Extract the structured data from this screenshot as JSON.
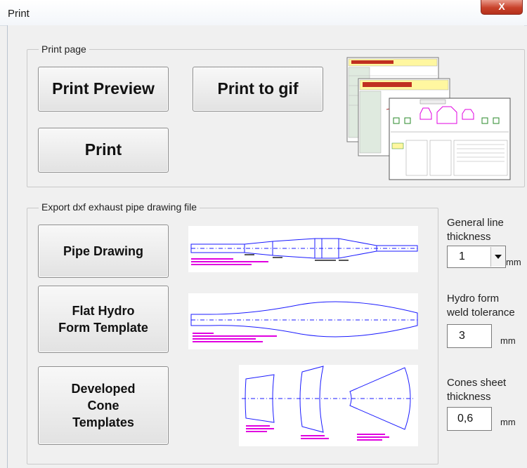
{
  "window": {
    "title": "Print",
    "close_glyph": "X"
  },
  "print_group": {
    "legend": "Print page",
    "print_preview_label": "Print Preview",
    "print_to_gif_label": "Print to gif",
    "print_label": "Print"
  },
  "export_group": {
    "legend": "Export dxf exhaust pipe drawing file",
    "pipe_drawing_label": "Pipe Drawing",
    "flat_hydro_label_1": "Flat Hydro",
    "flat_hydro_label_2": "Form Template",
    "developed_cone_label_1": "Developed",
    "developed_cone_label_2": "Cone",
    "developed_cone_label_3": "Templates"
  },
  "settings": {
    "line_thickness_label_1": "General line",
    "line_thickness_label_2": "thickness",
    "line_thickness_value": "1",
    "line_thickness_unit": "mm",
    "weld_tolerance_label_1": "Hydro form",
    "weld_tolerance_label_2": "weld tolerance",
    "weld_tolerance_value": "3",
    "weld_tolerance_unit": "mm",
    "cones_thickness_label_1": "Cones sheet",
    "cones_thickness_label_2": "thickness",
    "cones_thickness_value": "0,6",
    "cones_thickness_unit": "mm"
  },
  "icons": {
    "close": "close-icon",
    "dropdown": "chevron-down-icon"
  },
  "colors": {
    "drawing_line": "#1a1aff",
    "annotation": "#e000e0",
    "close_button": "#c8422b"
  }
}
